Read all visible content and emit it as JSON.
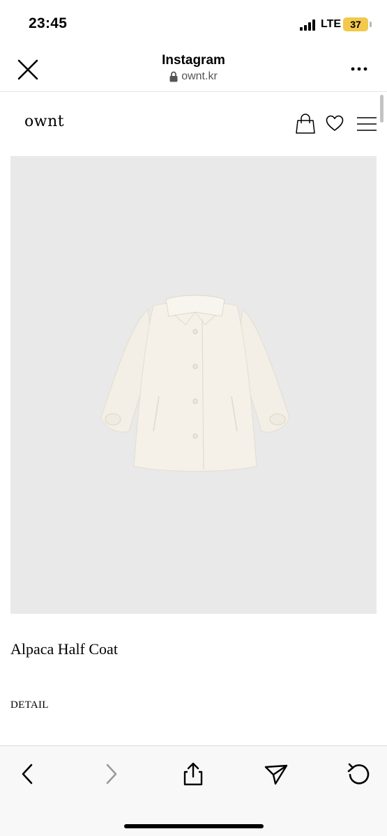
{
  "status_bar": {
    "time": "23:45",
    "network": "LTE",
    "battery": "37"
  },
  "browser": {
    "title": "Instagram",
    "url": "ownt.kr",
    "icons": {
      "close": "close-icon",
      "lock": "lock-icon",
      "more": "more-icon"
    }
  },
  "site": {
    "logo": "ownt",
    "icons": {
      "bag": "shopping-bag-icon",
      "wishlist": "heart-icon",
      "menu": "hamburger-menu-icon"
    }
  },
  "product": {
    "name": "Alpaca Half Coat",
    "detail_label": "DETAIL",
    "image": {
      "background_color": "#e9e9e9",
      "item_color": "#f4f0e7"
    }
  },
  "toolbar": {
    "icons": [
      "back-icon",
      "forward-icon",
      "share-icon",
      "send-icon",
      "reload-icon"
    ]
  }
}
